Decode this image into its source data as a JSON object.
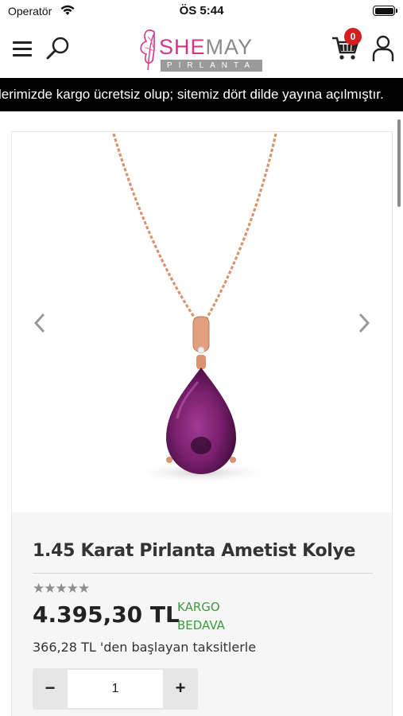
{
  "status_bar": {
    "carrier": "Operatör",
    "time": "ÖS 5:44"
  },
  "header": {
    "logo": {
      "brand_she": "SHE",
      "brand_may": "MAY",
      "tagline": "PIRLANTA"
    },
    "cart_count": "0",
    "icons": [
      "menu-icon",
      "search-icon",
      "cart-icon",
      "user-icon"
    ]
  },
  "announcement": {
    "text": "lerimizde kargo ücretsiz olup; sitemiz dört dilde yayına açılmıştır."
  },
  "product": {
    "title": "1.45 Karat Pirlanta Ametist Kolye",
    "rating_stars": "★★★★★",
    "price": "4.395,30 TL",
    "shipping_line1": "KARGO",
    "shipping_line2": "BEDAVA",
    "installment": "366,28 TL 'den başlayan taksitlerle",
    "quantity": "1",
    "qty_minus": "−",
    "qty_plus": "+"
  },
  "colors": {
    "brand_pink": "#d8338a",
    "brand_gray": "#8a8a8a",
    "badge_red": "#d41e1e",
    "shipping_green": "#3c9b3c",
    "amethyst": "#7a1f6e",
    "rose_gold": "#d9936e"
  }
}
